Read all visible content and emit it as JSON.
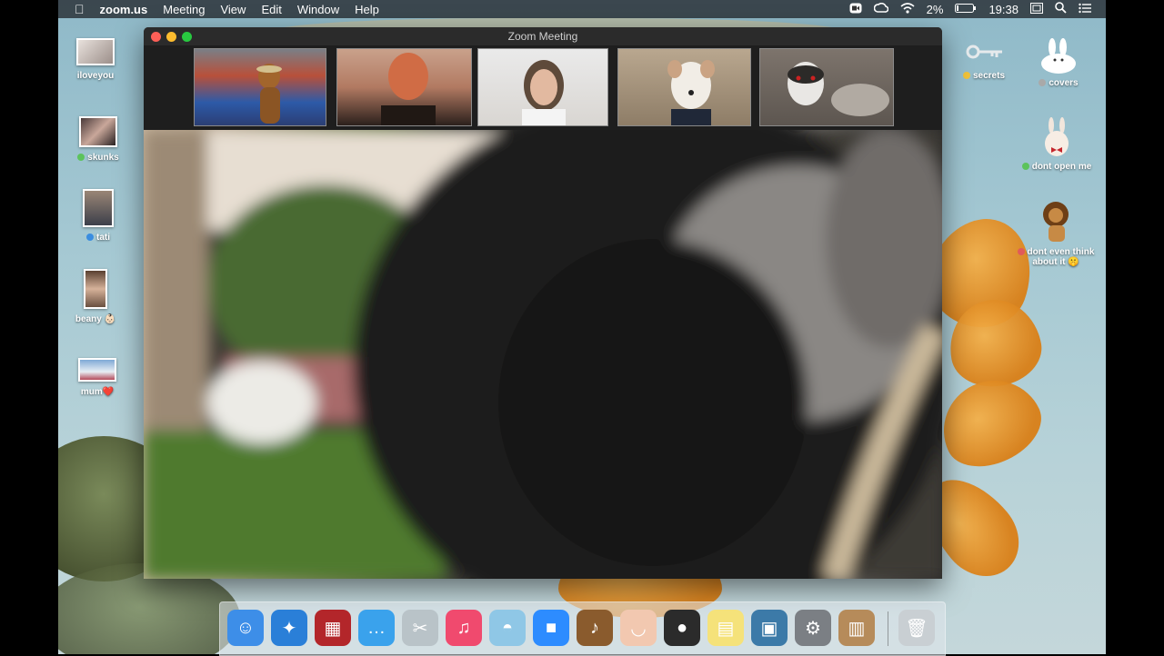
{
  "menubar": {
    "app_name": "zoom.us",
    "menus": [
      "Meeting",
      "View",
      "Edit",
      "Window",
      "Help"
    ],
    "battery": "2%",
    "time": "19:38"
  },
  "desktop": {
    "left_icons": [
      {
        "label": "iloveyou",
        "dot": ""
      },
      {
        "label": "skunks",
        "dot": "#5cc35c"
      },
      {
        "label": "tati",
        "dot": "#3a8de0"
      },
      {
        "label": "beany 👶🏻",
        "dot": ""
      },
      {
        "label": "mum❤️",
        "dot": ""
      }
    ],
    "right_icons": [
      {
        "label": "secrets",
        "dot": "#f0c23a"
      },
      {
        "label": "covers",
        "dot": "#a9a9a9"
      },
      {
        "label": "dont open me",
        "dot": "#5cc35c"
      },
      {
        "label": "dont even think about it 🤫",
        "dot": "#e05a5a"
      }
    ]
  },
  "window": {
    "title": "Zoom Meeting",
    "participants": [
      {
        "name": "participant-1"
      },
      {
        "name": "participant-2"
      },
      {
        "name": "participant-3"
      },
      {
        "name": "participant-4"
      },
      {
        "name": "participant-5"
      }
    ]
  },
  "dock": {
    "apps": [
      {
        "name": "finder-icon",
        "color": "#3d8ee8",
        "glyph": "☺"
      },
      {
        "name": "safari-icon",
        "color": "#2a7fd8",
        "glyph": "✦"
      },
      {
        "name": "photo-booth-icon",
        "color": "#b3262a",
        "glyph": "▦"
      },
      {
        "name": "messages-icon",
        "color": "#3aa2ec",
        "glyph": "…"
      },
      {
        "name": "rabbit-app-icon",
        "color": "#b9c3c8",
        "glyph": "✂"
      },
      {
        "name": "music-icon",
        "color": "#f04a6e",
        "glyph": "♫"
      },
      {
        "name": "seal-app-icon",
        "color": "#8fc7e6",
        "glyph": "◓"
      },
      {
        "name": "zoom-icon",
        "color": "#2d8cff",
        "glyph": "■"
      },
      {
        "name": "garageband-icon",
        "color": "#8a5b2d",
        "glyph": "♪"
      },
      {
        "name": "face-app-icon",
        "color": "#f2c8b0",
        "glyph": "◡"
      },
      {
        "name": "photo-booth-red-icon",
        "color": "#2b2b2b",
        "glyph": "●"
      },
      {
        "name": "stickies-icon",
        "color": "#f5e27a",
        "glyph": "▤"
      },
      {
        "name": "preview-icon",
        "color": "#3c7aa8",
        "glyph": "▣"
      },
      {
        "name": "system-preferences-icon",
        "color": "#7b7f84",
        "glyph": "⚙"
      },
      {
        "name": "contacts-icon",
        "color": "#b68b5a",
        "glyph": "▥"
      },
      {
        "name": "trash-icon",
        "color": "#c9cfd3",
        "glyph": "🗑"
      }
    ]
  }
}
